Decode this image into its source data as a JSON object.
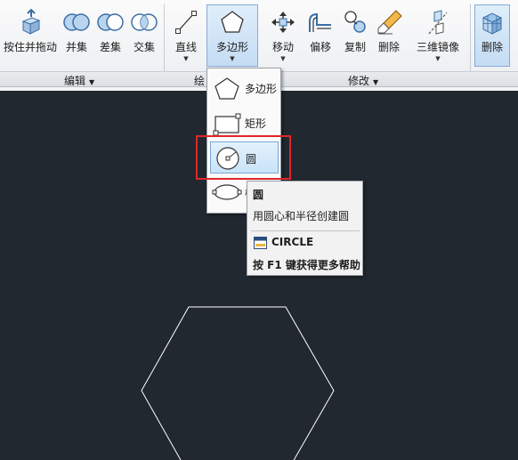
{
  "ribbon": {
    "buttons": {
      "extrude": "按住并拖动",
      "union": "并集",
      "subtract": "差集",
      "intersect": "交集",
      "line": "直线",
      "polygon": "多边形",
      "move": "移动",
      "offset": "偏移",
      "copy": "复制",
      "erase": "删除",
      "mirror3d": "三维镜像",
      "delete_right": "删除"
    },
    "groups": {
      "edit": "编辑",
      "draw": "绘",
      "modify": "修改"
    }
  },
  "dropdown": {
    "items": [
      {
        "label": "多边形"
      },
      {
        "label": "矩形"
      },
      {
        "label": "圆"
      },
      {
        "label": "椭"
      }
    ]
  },
  "tooltip": {
    "title": "圆",
    "description": "用圆心和半径创建圆",
    "command": "CIRCLE",
    "help": "按 F1 键获得更多帮助"
  },
  "colors": {
    "canvas": "#212830",
    "highlight": "#e0262a",
    "drawing": "#ffffff"
  }
}
